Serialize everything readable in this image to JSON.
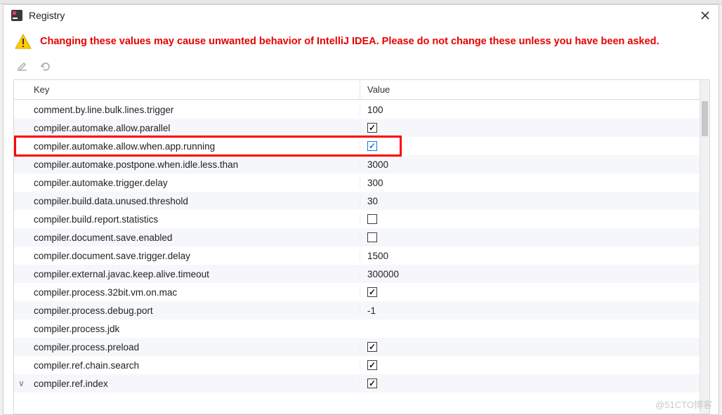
{
  "window": {
    "title": "Registry",
    "close_tooltip": "Close"
  },
  "warning": {
    "text": "Changing these values may cause unwanted behavior of IntelliJ IDEA. Please do not change these unless you have been asked."
  },
  "toolbar": {
    "edit_label": "Edit",
    "undo_label": "Undo"
  },
  "table": {
    "header_key": "Key",
    "header_value": "Value",
    "rows": [
      {
        "key": "comment.by.line.bulk.lines.trigger",
        "type": "text",
        "value": "100",
        "highlighted": false
      },
      {
        "key": "compiler.automake.allow.parallel",
        "type": "checkbox",
        "checked": true,
        "highlighted": false
      },
      {
        "key": "compiler.automake.allow.when.app.running",
        "type": "checkbox",
        "checked": true,
        "highlighted": true,
        "blue": true
      },
      {
        "key": "compiler.automake.postpone.when.idle.less.than",
        "type": "text",
        "value": "3000",
        "highlighted": false
      },
      {
        "key": "compiler.automake.trigger.delay",
        "type": "text",
        "value": "300",
        "highlighted": false
      },
      {
        "key": "compiler.build.data.unused.threshold",
        "type": "text",
        "value": "30",
        "highlighted": false
      },
      {
        "key": "compiler.build.report.statistics",
        "type": "checkbox",
        "checked": false,
        "highlighted": false
      },
      {
        "key": "compiler.document.save.enabled",
        "type": "checkbox",
        "checked": false,
        "highlighted": false
      },
      {
        "key": "compiler.document.save.trigger.delay",
        "type": "text",
        "value": "1500",
        "highlighted": false
      },
      {
        "key": "compiler.external.javac.keep.alive.timeout",
        "type": "text",
        "value": "300000",
        "highlighted": false
      },
      {
        "key": "compiler.process.32bit.vm.on.mac",
        "type": "checkbox",
        "checked": true,
        "highlighted": false
      },
      {
        "key": "compiler.process.debug.port",
        "type": "text",
        "value": "-1",
        "highlighted": false
      },
      {
        "key": "compiler.process.jdk",
        "type": "text",
        "value": "",
        "highlighted": false
      },
      {
        "key": "compiler.process.preload",
        "type": "checkbox",
        "checked": true,
        "highlighted": false
      },
      {
        "key": "compiler.ref.chain.search",
        "type": "checkbox",
        "checked": true,
        "highlighted": false
      },
      {
        "key": "compiler.ref.index",
        "type": "checkbox",
        "checked": true,
        "highlighted": false,
        "expanded": true
      }
    ]
  },
  "watermark": "@51CTO博客"
}
